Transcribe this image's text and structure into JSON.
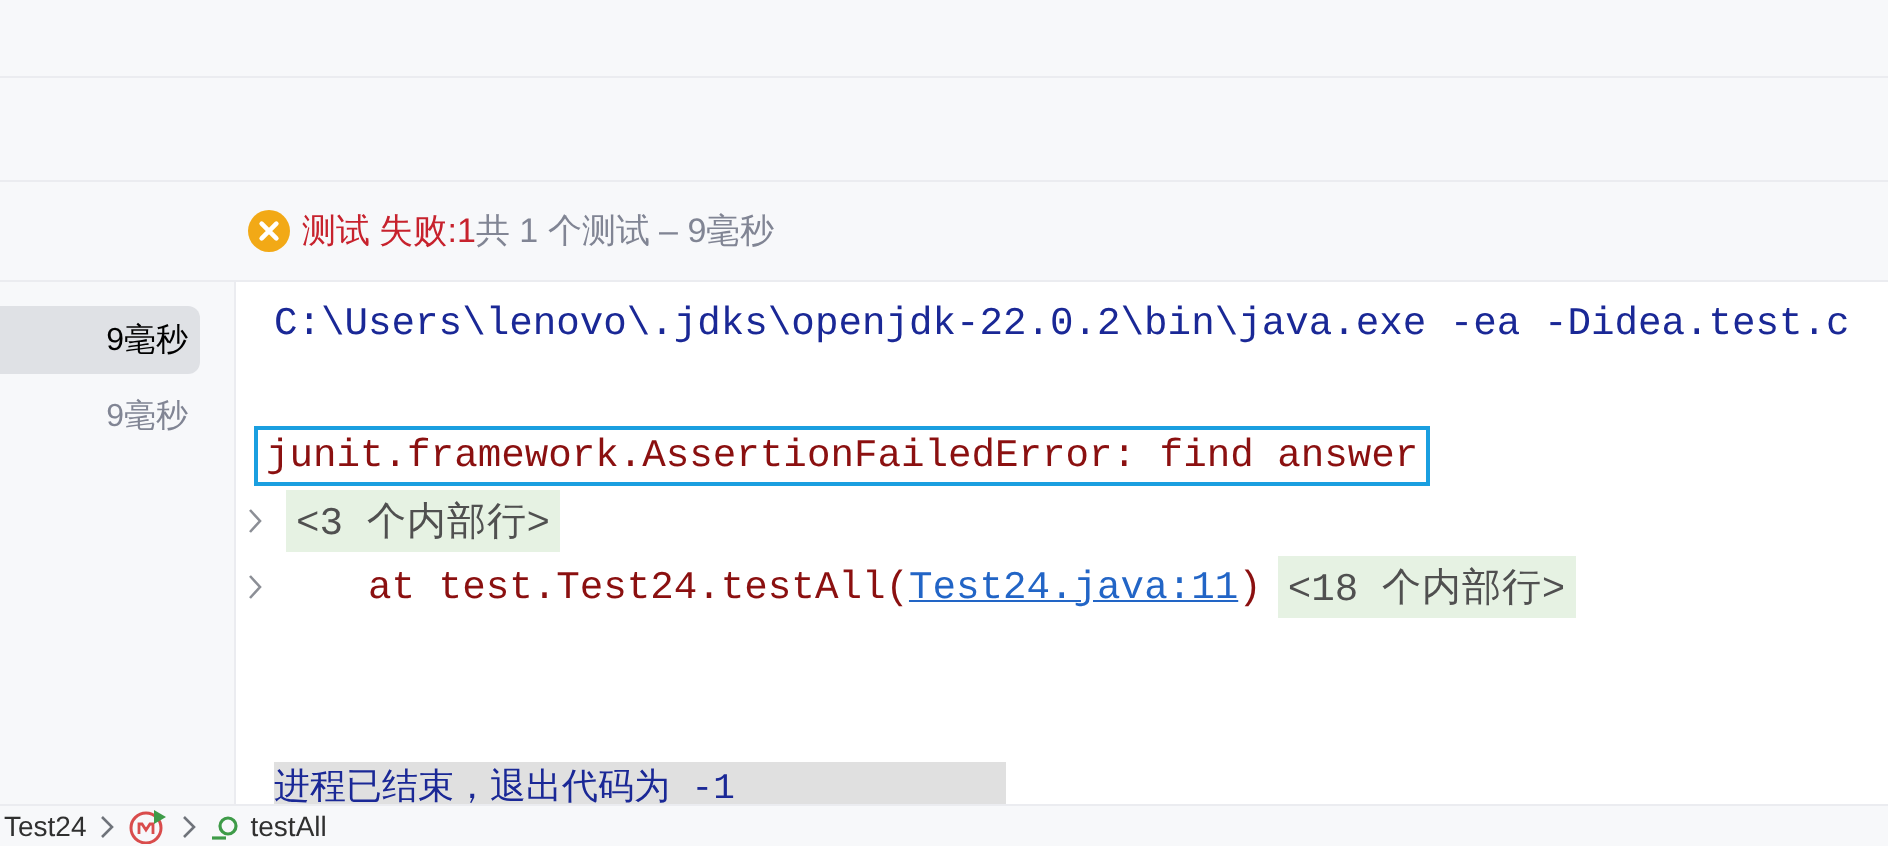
{
  "status": {
    "failed_label": "测试 失败:",
    "failed_count": "1",
    "summary": "共 1 个测试 – 9毫秒"
  },
  "tests": [
    {
      "duration": "9毫秒",
      "selected": true
    },
    {
      "duration": "9毫秒",
      "selected": false
    }
  ],
  "console": [
    {
      "kind": "command",
      "text": "C:\\Users\\lenovo\\.jdks\\openjdk-22.0.2\\bin\\java.exe -ea -Didea.test.c"
    },
    {
      "kind": "blank"
    },
    {
      "kind": "error",
      "text": "junit.framework.AssertionFailedError: find answer",
      "highlighted": true
    },
    {
      "kind": "fold",
      "expanded": false,
      "text": "<3 个内部行>"
    },
    {
      "kind": "stack",
      "expanded": false,
      "prefix": "    at test.Test24.testAll(",
      "link": "Test24.java:11",
      "suffix": ")",
      "fold": "<18 个内部行>"
    },
    {
      "kind": "blank"
    },
    {
      "kind": "blank"
    },
    {
      "kind": "exit",
      "text": "进程已结束，退出代码为 -1"
    }
  ],
  "breadcrumb": [
    {
      "kind": "text",
      "text": "Test24"
    },
    {
      "kind": "class"
    },
    {
      "kind": "method",
      "text": "testAll"
    }
  ]
}
